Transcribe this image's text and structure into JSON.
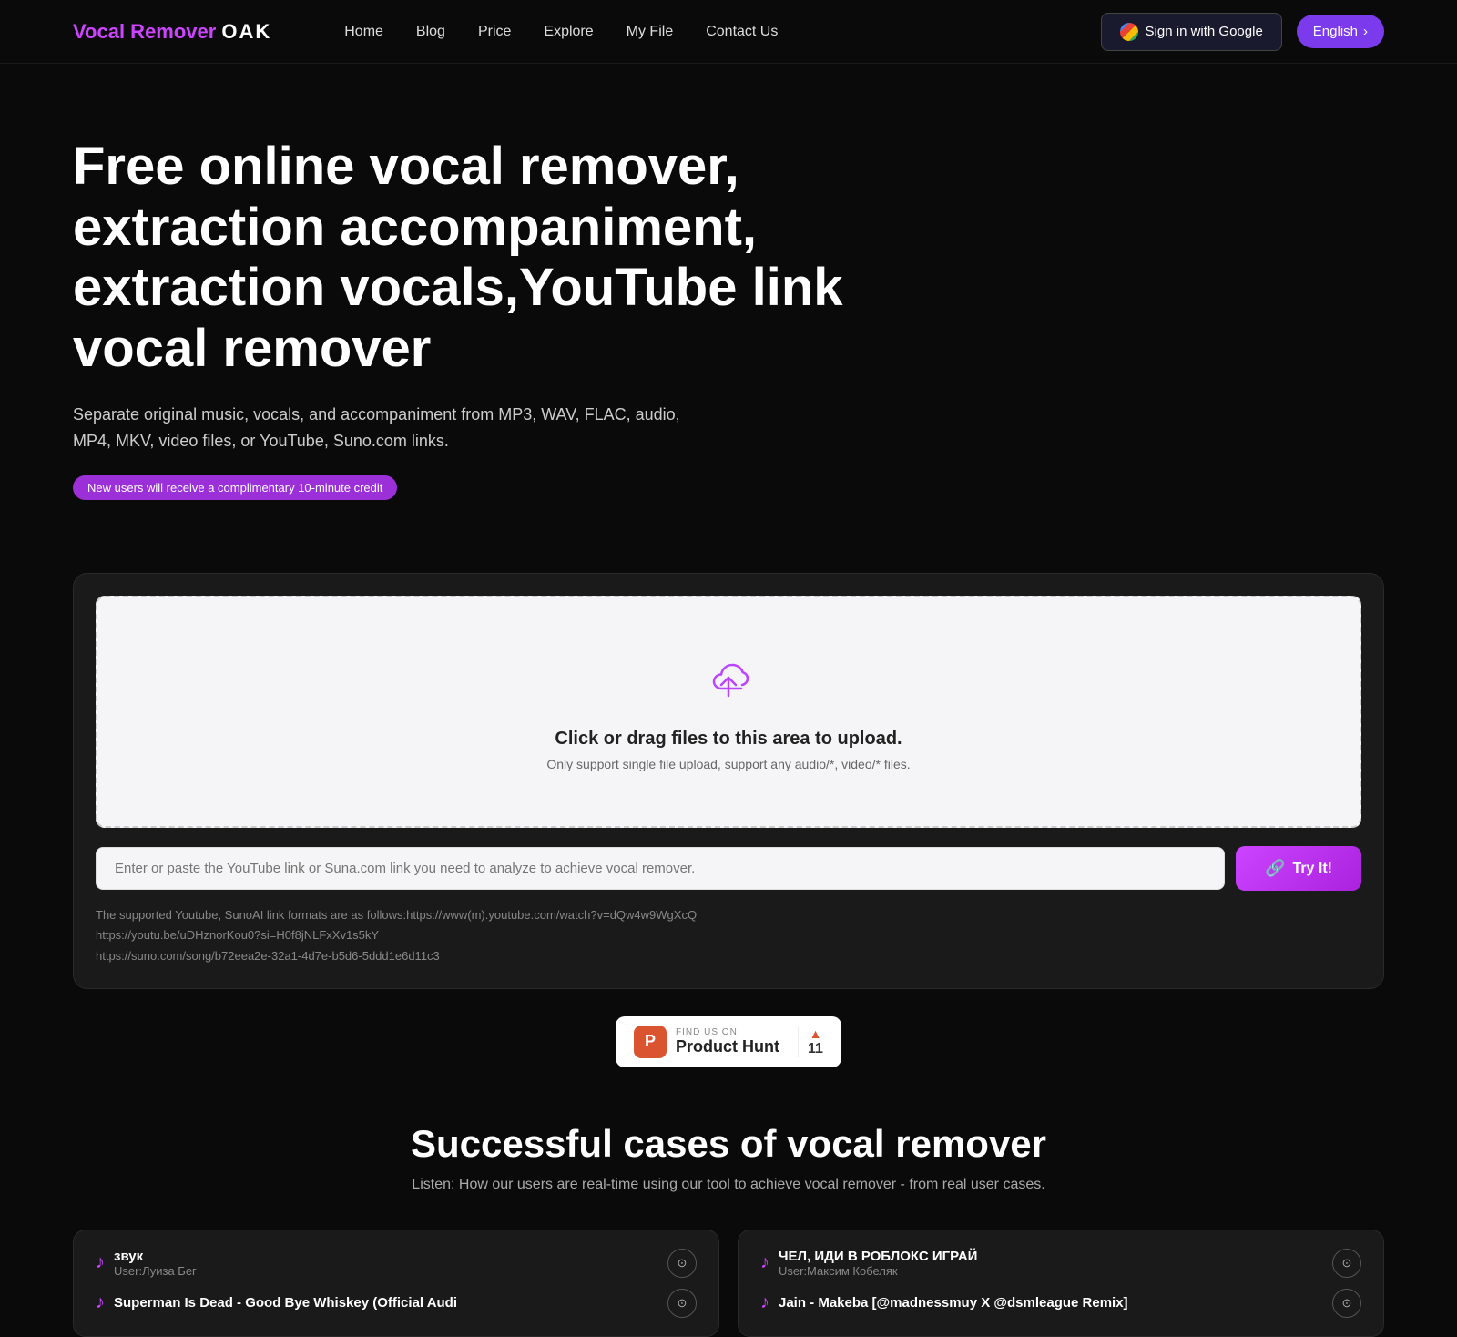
{
  "header": {
    "logo": {
      "vocal": "Vocal Remover",
      "oak": "OAK"
    },
    "nav": [
      {
        "label": "Home",
        "id": "home"
      },
      {
        "label": "Blog",
        "id": "blog"
      },
      {
        "label": "Price",
        "id": "price"
      },
      {
        "label": "Explore",
        "id": "explore"
      },
      {
        "label": "My File",
        "id": "my-file"
      },
      {
        "label": "Contact Us",
        "id": "contact-us"
      }
    ],
    "google_btn": "Sign in with Google",
    "language_btn": "English"
  },
  "hero": {
    "headline": "Free online vocal remover, extraction accompaniment, extraction vocals,YouTube link vocal remover",
    "subtext": "Separate original music, vocals, and accompaniment from MP3, WAV, FLAC, audio, MP4, MKV, video files, or YouTube, Suno.com links.",
    "badge": "New users will receive a complimentary 10-minute credit"
  },
  "upload": {
    "dropzone_title": "Click or drag files to this area to upload.",
    "dropzone_subtitle": "Only support single file upload, support any audio/*, video/* files.",
    "url_placeholder": "Enter or paste the YouTube link or Suna.com link you need to analyze to achieve vocal remover.",
    "try_it_label": "Try It!",
    "hint_line1": "The supported Youtube, SunoAI link formats are as follows:https://www(m).youtube.com/watch?v=dQw4w9WgXcQ",
    "hint_line2": "https://youtu.be/uDHznorKou0?si=H0f8jNLFxXv1s5kY",
    "hint_line3": "https://suno.com/song/b72eea2e-32a1-4d7e-b5d6-5ddd1e6d11c3"
  },
  "product_hunt": {
    "find_us_on": "FIND US ON",
    "name": "Product Hunt",
    "count": "11"
  },
  "cases_section": {
    "title": "Successful cases of vocal remover",
    "subtitle": "Listen: How our users are real-time using our tool to achieve vocal remover - from real user cases."
  },
  "case_cards": [
    {
      "id": "card1",
      "track1_name": "звук",
      "track1_user": "User:Луиза Бег",
      "track2_name": "Superman Is Dead - Good Bye Whiskey (Official Audi",
      "track2_user": ""
    },
    {
      "id": "card2",
      "track1_name": "ЧЕЛ, ИДИ В РОБЛОКС ИГРАЙ",
      "track1_user": "User:Максим Кобеляк",
      "track2_name": "Jain - Makeba [@madnessmuy X @dsmleague Remix]",
      "track2_user": ""
    }
  ]
}
